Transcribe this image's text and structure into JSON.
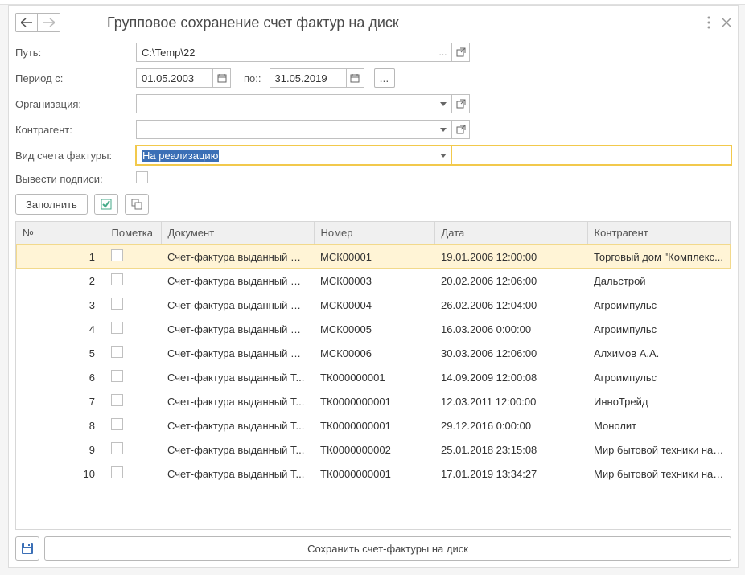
{
  "title": "Групповое сохранение счет фактур на диск",
  "labels": {
    "path": "Путь:",
    "period_from": "Период с:",
    "period_to": "по::",
    "organization": "Организация:",
    "contractor": "Контрагент:",
    "invoice_type": "Вид счета фактуры:",
    "show_signatures": "Вывести подписи:"
  },
  "fields": {
    "path": "C:\\Temp\\22",
    "period_from": "01.05.2003",
    "period_to": "31.05.2019",
    "organization": "",
    "contractor": "",
    "invoice_type": "На реализацию",
    "show_signatures": false
  },
  "buttons": {
    "fill": "Заполнить",
    "ellipsis": "...",
    "save_main": "Сохранить счет-фактуры на диск"
  },
  "table": {
    "headers": {
      "num": "№",
      "mark": "Пометка",
      "doc": "Документ",
      "number": "Номер",
      "date": "Дата",
      "contractor": "Контрагент"
    },
    "rows": [
      {
        "num": 1,
        "mark": false,
        "doc": "Счет-фактура выданный М...",
        "number": "МСК00001",
        "date": "19.01.2006 12:00:00",
        "contractor": "Торговый дом \"Комплекс..."
      },
      {
        "num": 2,
        "mark": false,
        "doc": "Счет-фактура выданный М...",
        "number": "МСК00003",
        "date": "20.02.2006 12:06:00",
        "contractor": "Дальстрой"
      },
      {
        "num": 3,
        "mark": false,
        "doc": "Счет-фактура выданный М...",
        "number": "МСК00004",
        "date": "26.02.2006 12:04:00",
        "contractor": "Агроимпульс"
      },
      {
        "num": 4,
        "mark": false,
        "doc": "Счет-фактура выданный М...",
        "number": "МСК00005",
        "date": "16.03.2006 0:00:00",
        "contractor": "Агроимпульс"
      },
      {
        "num": 5,
        "mark": false,
        "doc": "Счет-фактура выданный М...",
        "number": "МСК00006",
        "date": "30.03.2006 12:06:00",
        "contractor": "Алхимов А.А."
      },
      {
        "num": 6,
        "mark": false,
        "doc": "Счет-фактура выданный Т...",
        "number": "ТК000000001",
        "date": "14.09.2009 12:00:08",
        "contractor": "Агроимпульс"
      },
      {
        "num": 7,
        "mark": false,
        "doc": "Счет-фактура выданный Т...",
        "number": "ТК0000000001",
        "date": "12.03.2011 12:00:00",
        "contractor": "ИнноТрейд"
      },
      {
        "num": 8,
        "mark": false,
        "doc": "Счет-фактура выданный Т...",
        "number": "ТК0000000001",
        "date": "29.12.2016 0:00:00",
        "contractor": "Монолит"
      },
      {
        "num": 9,
        "mark": false,
        "doc": "Счет-фактура выданный Т...",
        "number": "ТК0000000002",
        "date": "25.01.2018 23:15:08",
        "contractor": "Мир бытовой техники на ..."
      },
      {
        "num": 10,
        "mark": false,
        "doc": "Счет-фактура выданный Т...",
        "number": "ТК0000000001",
        "date": "17.01.2019 13:34:27",
        "contractor": "Мир бытовой техники на ..."
      }
    ],
    "selected_row_index": 0
  }
}
